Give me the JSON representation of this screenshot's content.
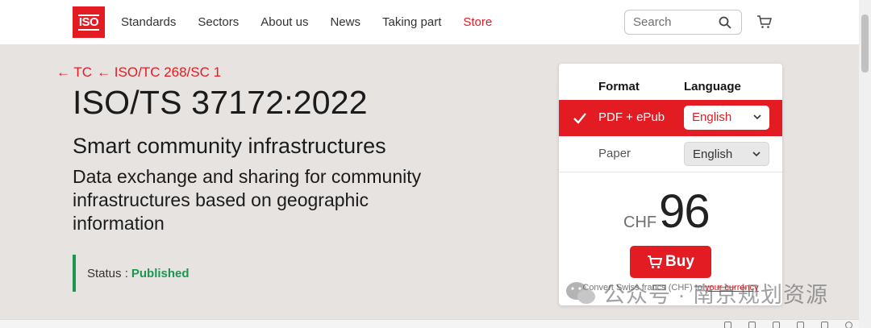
{
  "header": {
    "logo_text": "ISO",
    "nav": [
      "Standards",
      "Sectors",
      "About us",
      "News",
      "Taking part",
      "Store"
    ],
    "search_placeholder": "Search"
  },
  "breadcrumb": [
    "← TC",
    "← ISO/TC 268/SC 1"
  ],
  "standard": {
    "title": "ISO/TS 37172:2022",
    "subtitle": "Smart community infrastructures",
    "description": "Data exchange and sharing for community infrastructures based on geographic information",
    "status_label": "Status :",
    "status_value": "Published"
  },
  "purchase": {
    "format_header": "Format",
    "language_header": "Language",
    "options": [
      {
        "format": "PDF + ePub",
        "language": "English",
        "selected": true
      },
      {
        "format": "Paper",
        "language": "English",
        "selected": false
      }
    ],
    "currency": "CHF",
    "price": "96",
    "buy_label": "Buy",
    "convert_prefix": "Convert Swiss francs (CHF) to",
    "convert_link": "your currency"
  },
  "watermark": "公众号 · 南京规划资源",
  "colors": {
    "brand": "#e31b23",
    "published": "#1a9850",
    "background": "#e6e3e1"
  }
}
